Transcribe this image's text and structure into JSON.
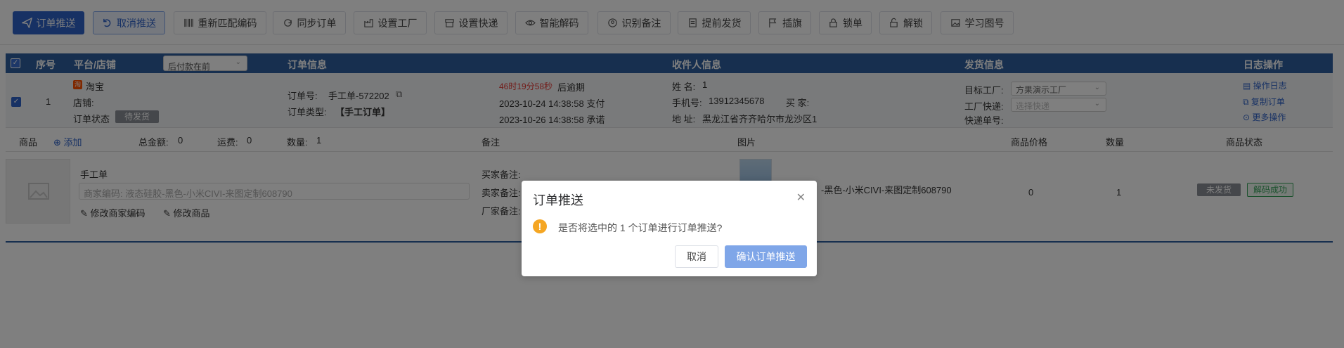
{
  "toolbar": {
    "buttons": [
      {
        "label": "订单推送",
        "icon": "send-icon"
      },
      {
        "label": "取消推送",
        "icon": "undo-icon"
      },
      {
        "label": "重新匹配编码",
        "icon": "barcode-icon"
      },
      {
        "label": "同步订单",
        "icon": "sync-icon"
      },
      {
        "label": "设置工厂",
        "icon": "factory-icon"
      },
      {
        "label": "设置快递",
        "icon": "box-icon"
      },
      {
        "label": "智能解码",
        "icon": "eye-icon"
      },
      {
        "label": "识别备注",
        "icon": "scan-icon"
      },
      {
        "label": "提前发货",
        "icon": "doc-icon"
      },
      {
        "label": "插旗",
        "icon": "flag-icon"
      },
      {
        "label": "锁单",
        "icon": "lock-icon"
      },
      {
        "label": "解锁",
        "icon": "unlock-icon"
      },
      {
        "label": "学习图号",
        "icon": "image-icon"
      }
    ]
  },
  "table_header": {
    "seq": "序号",
    "platform": "平台/店铺",
    "sort_select": "后付款在前",
    "order_info": "订单信息",
    "receiver": "收件人信息",
    "shipping": "发货信息",
    "log": "日志操作"
  },
  "order": {
    "seq": "1",
    "platform": "淘宝",
    "platform_icon_text": "淘",
    "shop_label": "店铺:",
    "status_label": "订单状态",
    "status_value": "待发货",
    "order_no_label": "订单号:",
    "order_no": "手工单-572202",
    "order_type_label": "订单类型:",
    "order_type": "【手工订单】",
    "countdown": "46时19分58秒",
    "countdown_suffix": "后逾期",
    "paid_time": "2023-10-24 14:38:58 支付",
    "promise_time": "2023-10-26 14:38:58 承诺",
    "name_label": "姓 名:",
    "name": "1",
    "phone_label": "手机号:",
    "phone": "13912345678",
    "buyer_label": "买 家:",
    "address_label": "地 址:",
    "address": "黑龙江省齐齐哈尔市龙沙区1",
    "target_factory_label": "目标工厂:",
    "target_factory": "方果演示工厂",
    "factory_express_label": "工厂快递:",
    "factory_express_placeholder": "选择快递",
    "tracking_label": "快递单号:",
    "log_link": "操作日志",
    "copy_link": "复制订单",
    "more_link": "更多操作",
    "accent_color": "#2f62c8",
    "countdown_color": "#e53935"
  },
  "product_header": {
    "product": "商品",
    "add": "添加",
    "total_label": "总金额:",
    "total": "0",
    "freight_label": "运费:",
    "freight": "0",
    "qty_label": "数量:",
    "qty": "1",
    "remark": "备注",
    "image": "图片",
    "price": "商品价格",
    "quantity": "数量",
    "status": "商品状态"
  },
  "product": {
    "name": "手工单",
    "merchant_code_placeholder": "商家编码: 液态硅胶-黑色-小米CIVI-来图定制608790",
    "edit_code": "修改商家编码",
    "edit_product": "修改商品",
    "buyer_remark": "买家备注:",
    "seller_remark": "卖家备注:",
    "factory_remark": "厂家备注:",
    "spec": "-黑色-小米CIVI-来图定制608790",
    "price": "0",
    "qty": "1",
    "ship_status": "未发货",
    "decode_status": "解码成功"
  },
  "dialog": {
    "title": "订单推送",
    "message": "是否将选中的 1 个订单进行订单推送?",
    "cancel": "取消",
    "confirm": "确认订单推送"
  }
}
